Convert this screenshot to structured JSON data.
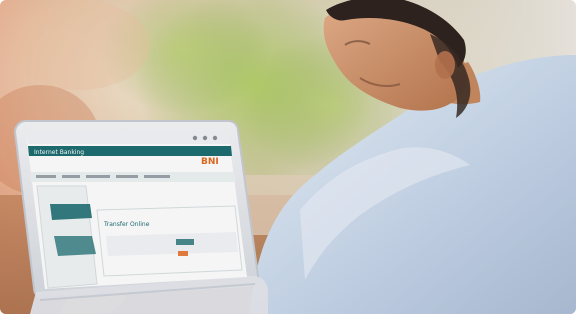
{
  "scene": {
    "logo_text": "BNI",
    "banking_header": "Internet Banking",
    "panel_title": "Transfer Online",
    "colors": {
      "brand_teal": "#1e6f73",
      "brand_orange": "#e56a1f",
      "shirt": "#c7d6ea",
      "foliage": "#9fbf5a",
      "wall_warm": "#d99a6a"
    },
    "icons": [
      "laptop-icon",
      "person-icon",
      "plant-icon"
    ]
  }
}
